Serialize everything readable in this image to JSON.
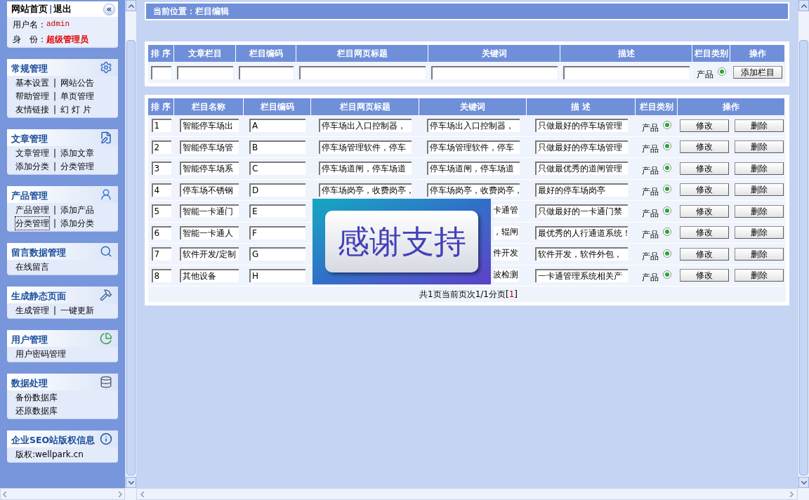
{
  "sidebar": {
    "top": {
      "home": "网站首页",
      "separator": "|",
      "logout": "退出",
      "collapse": "«",
      "user_label": "用户名：",
      "user_value": "admin",
      "role_label": "身　份：",
      "role_value": "超级管理员"
    },
    "groups": [
      {
        "title": "常规管理",
        "rows": [
          [
            {
              "label": "基本设置",
              "focused": false
            },
            {
              "label": "网站公告",
              "focused": false
            }
          ],
          [
            {
              "label": "帮助管理",
              "focused": false
            },
            {
              "label": "单页管理",
              "focused": false
            }
          ],
          [
            {
              "label": "友情链接",
              "focused": false
            },
            {
              "label": "幻 灯 片",
              "focused": false
            }
          ]
        ]
      },
      {
        "title": "文章管理",
        "rows": [
          [
            {
              "label": "文章管理",
              "focused": false
            },
            {
              "label": "添加文章",
              "focused": false
            }
          ],
          [
            {
              "label": "添加分类",
              "focused": false
            },
            {
              "label": "分类管理",
              "focused": false
            }
          ]
        ]
      },
      {
        "title": "产品管理",
        "rows": [
          [
            {
              "label": "产品管理",
              "focused": false
            },
            {
              "label": "添加产品",
              "focused": false
            }
          ],
          [
            {
              "label": "分类管理",
              "focused": true
            },
            {
              "label": "添加分类",
              "focused": false
            }
          ]
        ]
      },
      {
        "title": "留言数据管理",
        "rows": [
          [
            {
              "label": "在线留言",
              "focused": false
            }
          ]
        ]
      },
      {
        "title": "生成静态页面",
        "rows": [
          [
            {
              "label": "生成管理",
              "focused": false
            },
            {
              "label": "一键更新",
              "focused": false
            }
          ]
        ]
      },
      {
        "title": "用户管理",
        "rows": [
          [
            {
              "label": "用户密码管理",
              "focused": false
            }
          ]
        ]
      },
      {
        "title": "数据处理",
        "rows": [
          [
            {
              "label": "备份数据库",
              "focused": false
            }
          ],
          [
            {
              "label": "还原数据库",
              "focused": false
            }
          ]
        ]
      },
      {
        "title": "企业SEO站版权信息",
        "rows": [
          [
            {
              "label": "版权:wellpark.cn",
              "focused": false
            }
          ]
        ]
      }
    ],
    "separator": "|"
  },
  "breadcrumb": "当前位置：栏目编辑",
  "add_form": {
    "columns": [
      "排 序",
      "文章栏目",
      "栏目编码",
      "栏目网页标题",
      "关键词",
      "描述",
      "栏目类别",
      "操作"
    ],
    "category": {
      "label": "产品",
      "selected": true
    },
    "button": "添加栏目"
  },
  "table": {
    "columns": [
      "排 序",
      "栏目名称",
      "栏目编码",
      "栏目网页标题",
      "关键词",
      "描 述",
      "栏目类别",
      "操作"
    ],
    "rows": [
      {
        "order": "1",
        "name": "智能停车场出",
        "code": "A",
        "title": "停车场出入口控制器，",
        "keywords": "停车场出入口控制器，",
        "description": "只做最好的停车场管理",
        "category": {
          "label": "产品",
          "selected": true
        },
        "edit_button": "修改",
        "delete_button": "删除"
      },
      {
        "order": "2",
        "name": "智能停车场管",
        "code": "B",
        "title": "停车场管理软件，停车",
        "keywords": "停车场管理软件，停车",
        "description": "只做最好的停车场管理",
        "category": {
          "label": "产品",
          "selected": true
        },
        "edit_button": "修改",
        "delete_button": "删除"
      },
      {
        "order": "3",
        "name": "智能停车场系",
        "code": "C",
        "title": "停车场道闸，停车场道",
        "keywords": "停车场道闸，停车场道",
        "description": "只做最优秀的道闸管理",
        "category": {
          "label": "产品",
          "selected": true
        },
        "edit_button": "修改",
        "delete_button": "删除"
      },
      {
        "order": "4",
        "name": "停车场不锈钢",
        "code": "D",
        "title": "停车场岗亭，收费岗亭，",
        "keywords": "停车场岗亭，收费岗亭，",
        "description": "最好的停车场岗亭",
        "category": {
          "label": "产品",
          "selected": true
        },
        "edit_button": "修改",
        "delete_button": "删除"
      },
      {
        "order": "5",
        "name": "智能一卡通门",
        "code": "E",
        "keywords": "卡通管",
        "description": "只做最好的一卡通门禁",
        "category": {
          "label": "产品",
          "selected": true
        },
        "edit_button": "修改",
        "delete_button": "删除"
      },
      {
        "order": "6",
        "name": "智能一卡通人",
        "code": "F",
        "keywords": "，辊闸",
        "description": "最优秀的人行通道系统！",
        "category": {
          "label": "产品",
          "selected": true
        },
        "edit_button": "修改",
        "delete_button": "删除"
      },
      {
        "order": "7",
        "name": "软件开发/定制",
        "code": "G",
        "keywords": "件开发",
        "description": "软件开发，软件外包，",
        "category": {
          "label": "产品",
          "selected": true
        },
        "edit_button": "修改",
        "delete_button": "删除"
      },
      {
        "order": "8",
        "name": "其他设备",
        "code": "H",
        "keywords": "波检测",
        "description": "一卡通管理系统相关产",
        "category": {
          "label": "产品",
          "selected": true
        },
        "edit_button": "修改",
        "delete_button": "删除"
      }
    ],
    "pagination": {
      "prefix": "共1页当前页次1/1分页[",
      "page": "1",
      "suffix": "]"
    }
  },
  "overlay": {
    "text": "感谢支持"
  }
}
